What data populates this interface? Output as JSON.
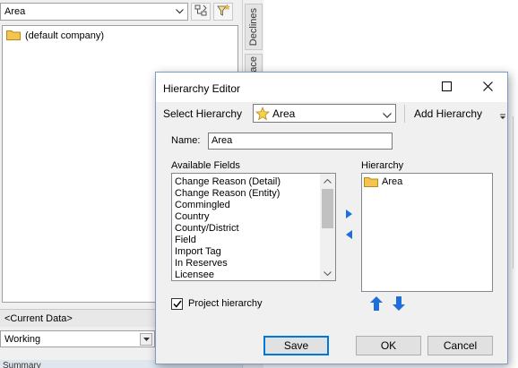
{
  "left_panel": {
    "hierarchy_select": {
      "value": "Area"
    },
    "tree": {
      "items": [
        {
          "label": "(default company)",
          "icon": "folder-icon"
        }
      ]
    },
    "current_data_label": "<Current Data>",
    "data_select": {
      "value": "Working"
    },
    "summary_label": "Summary"
  },
  "tabs": {
    "declines": "Declines",
    "partial": "ace"
  },
  "dialog": {
    "title": "Hierarchy Editor",
    "select_hierarchy_label": "Select Hierarchy",
    "select_hierarchy_value": "Area",
    "add_hierarchy_label": "Add Hierarchy",
    "name_label": "Name:",
    "name_value": "Area",
    "available_fields_label": "Available Fields",
    "available_fields": [
      "Change Reason (Detail)",
      "Change Reason (Entity)",
      "Commingled",
      "Country",
      "County/District",
      "Field",
      "Import Tag",
      "In Reserves",
      "Licensee"
    ],
    "hierarchy_label": "Hierarchy",
    "hierarchy_items": [
      {
        "label": "Area",
        "icon": "folder-icon"
      }
    ],
    "project_hierarchy_label": "Project hierarchy",
    "project_hierarchy_checked": true,
    "save_label": "Save",
    "ok_label": "OK",
    "cancel_label": "Cancel"
  },
  "colors": {
    "accent": "#0078d7",
    "arrow_blue": "#1e6fd9",
    "folder": "#f3c44f"
  }
}
